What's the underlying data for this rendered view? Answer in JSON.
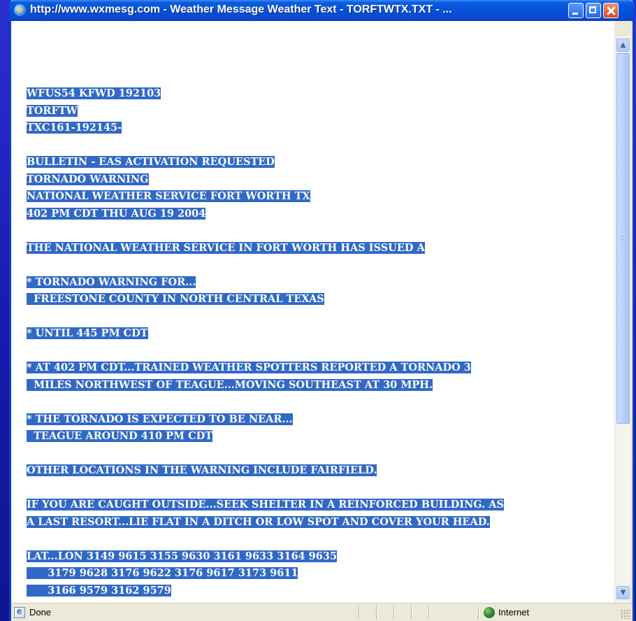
{
  "window": {
    "title": "http://www.wxmesg.com - Weather Message Weather Text - TORFTWTX.TXT - ..."
  },
  "bulletin": {
    "lines": [
      "WFUS54 KFWD 192103",
      "TORFTW",
      "TXC161-192145-",
      "",
      "BULLETIN - EAS ACTIVATION REQUESTED",
      "TORNADO WARNING",
      "NATIONAL WEATHER SERVICE FORT WORTH TX",
      "402 PM CDT THU AUG 19 2004",
      "",
      "THE NATIONAL WEATHER SERVICE IN FORT WORTH HAS ISSUED A",
      "",
      "* TORNADO WARNING FOR...",
      "  FREESTONE COUNTY IN NORTH CENTRAL TEXAS",
      "",
      "* UNTIL 445 PM CDT",
      "",
      "* AT 402 PM CDT...TRAINED WEATHER SPOTTERS REPORTED A TORNADO 3",
      "  MILES NORTHWEST OF TEAGUE...MOVING SOUTHEAST AT 30 MPH.",
      "",
      "* THE TORNADO IS EXPECTED TO BE NEAR...",
      "  TEAGUE AROUND 410 PM CDT",
      "",
      "OTHER LOCATIONS IN THE WARNING INCLUDE FAIRFIELD.",
      "",
      "IF YOU ARE CAUGHT OUTSIDE...SEEK SHELTER IN A REINFORCED BUILDING. AS",
      "A LAST RESORT...LIE FLAT IN A DITCH OR LOW SPOT AND COVER YOUR HEAD.",
      "",
      "LAT...LON 3149 9615 3155 9630 3161 9633 3164 9635",
      "      3179 9628 3176 9622 3176 9617 3173 9611",
      "      3166 9579 3162 9579"
    ]
  },
  "statusbar": {
    "status": "Done",
    "zone": "Internet"
  },
  "icons": {
    "title": "ie-page-icon",
    "status": "page-done-icon",
    "zone": "internet-globe-icon"
  },
  "colors": {
    "selection": "#3169c6",
    "titlebar": "#0551d8",
    "backdrop": "#1a1fb8"
  }
}
